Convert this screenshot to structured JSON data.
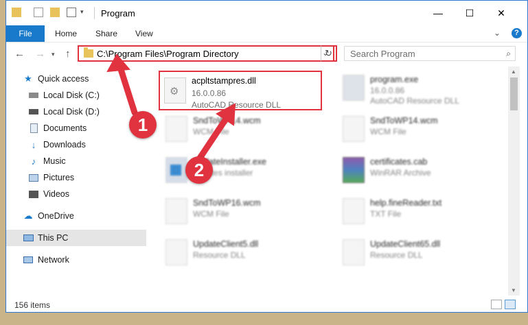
{
  "window": {
    "title": "Program",
    "controls": {
      "minimize": "—",
      "maximize": "☐",
      "close": "✕"
    }
  },
  "ribbon": {
    "file": "File",
    "tabs": [
      "Home",
      "Share",
      "View"
    ],
    "help": "?"
  },
  "nav": {
    "address": "C:\\Program Files\\Program Directory",
    "search_placeholder": "Search Program"
  },
  "sidebar": {
    "items": [
      {
        "label": "Quick access",
        "icon": "star-icon",
        "pinned": false
      },
      {
        "label": "Local Disk (C:)",
        "icon": "drive-icon",
        "pinned": true
      },
      {
        "label": "Local Disk (D:)",
        "icon": "drive-icon",
        "pinned": true
      },
      {
        "label": "Documents",
        "icon": "documents-icon",
        "pinned": true
      },
      {
        "label": "Downloads",
        "icon": "download-icon",
        "pinned": true
      },
      {
        "label": "Music",
        "icon": "music-icon",
        "pinned": true
      },
      {
        "label": "Pictures",
        "icon": "pictures-icon",
        "pinned": true
      },
      {
        "label": "Videos",
        "icon": "videos-icon",
        "pinned": true
      },
      {
        "label": "OneDrive",
        "icon": "cloud-icon",
        "pinned": false
      },
      {
        "label": "This PC",
        "icon": "computer-icon",
        "pinned": false,
        "selected": true
      },
      {
        "label": "Network",
        "icon": "network-icon",
        "pinned": false
      }
    ]
  },
  "files": [
    {
      "name": "acpltstampres.dll",
      "line1": "16.0.0.86",
      "line2": "AutoCAD Resource DLL",
      "highlighted": true
    },
    {
      "name": "program.exe",
      "line1": "16.0.0.86",
      "line2": "AutoCAD Resource DLL"
    },
    {
      "name": "SndToWP14.wcm",
      "line1": "WCM File",
      "line2": ""
    },
    {
      "name": "SndToWP14.wcm",
      "line1": "WCM File",
      "line2": ""
    },
    {
      "name": "UpdateInstaller.exe",
      "line1": "updates installer",
      "line2": ""
    },
    {
      "name": "certificates.cab",
      "line1": "WinRAR Archive",
      "line2": ""
    },
    {
      "name": "SndToWP16.wcm",
      "line1": "WCM File",
      "line2": ""
    },
    {
      "name": "help.fineReader.txt",
      "line1": "TXT File",
      "line2": ""
    },
    {
      "name": "UpdateClient5.dll",
      "line1": "Resource DLL",
      "line2": ""
    },
    {
      "name": "UpdateClient65.dll",
      "line1": "Resource DLL",
      "line2": ""
    }
  ],
  "status": {
    "count": "156 items"
  },
  "annotations": {
    "step1": "1",
    "step2": "2",
    "color": "#e0333f"
  }
}
